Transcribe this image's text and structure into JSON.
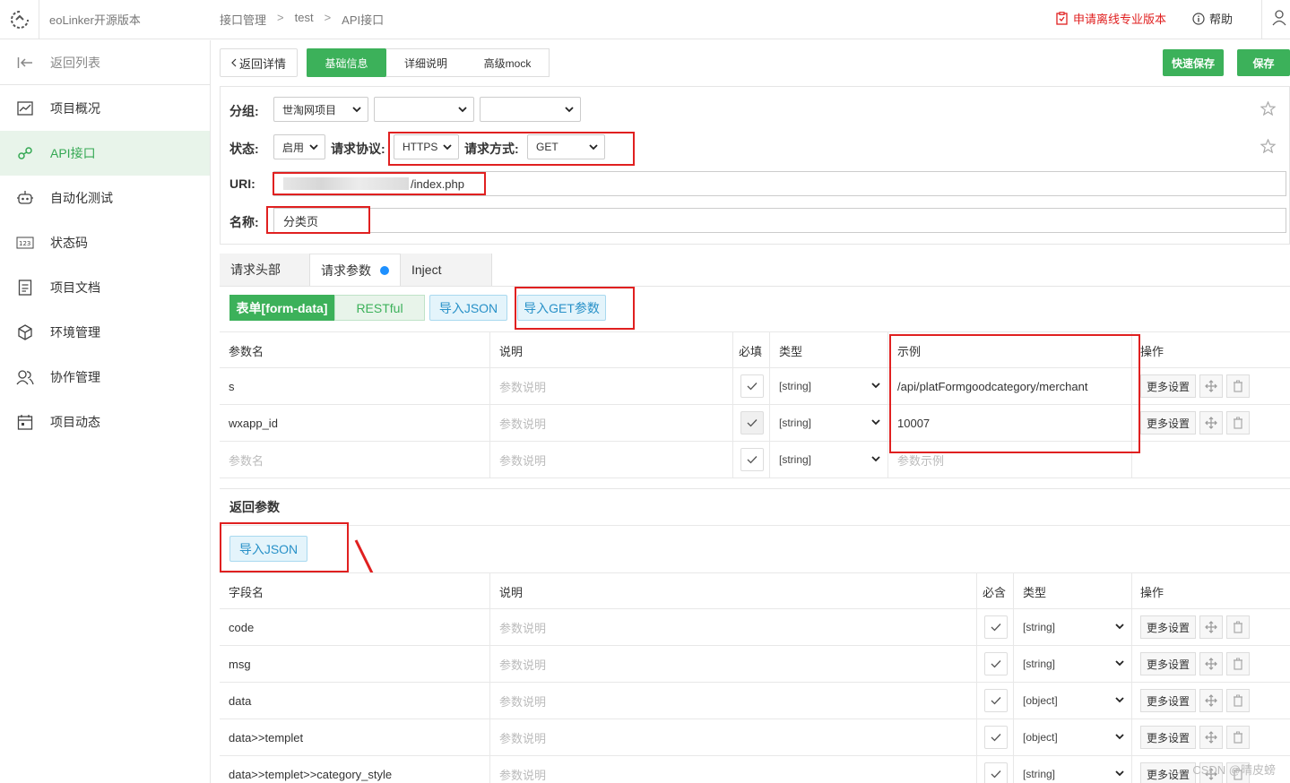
{
  "header": {
    "app_name": "eoLinker开源版本",
    "breadcrumbs": [
      "接口管理",
      "test",
      "API接口"
    ],
    "breadcrumb_sep": ">",
    "apply_label": "申请离线专业版本",
    "help_label": "帮助"
  },
  "sidebar": {
    "back_label": "返回列表",
    "items": [
      {
        "label": "项目概况",
        "icon": "chart-icon"
      },
      {
        "label": "API接口",
        "icon": "link-icon"
      },
      {
        "label": "自动化测试",
        "icon": "robot-icon"
      },
      {
        "label": "状态码",
        "icon": "code-icon"
      },
      {
        "label": "项目文档",
        "icon": "doc-icon"
      },
      {
        "label": "环境管理",
        "icon": "cube-icon"
      },
      {
        "label": "协作管理",
        "icon": "users-icon"
      },
      {
        "label": "项目动态",
        "icon": "calendar-icon"
      }
    ],
    "active": "API接口"
  },
  "toolbar": {
    "back_detail": "返回详情",
    "tabs": [
      "基础信息",
      "详细说明",
      "高级mock"
    ],
    "active_tab": "基础信息",
    "quick_save": "快速保存",
    "save": "保存"
  },
  "form": {
    "group_label": "分组:",
    "group_value": "世淘网项目",
    "status_label": "状态:",
    "status_value": "启用",
    "protocol_label": "请求协议:",
    "protocol_value": "HTTPS",
    "method_label": "请求方式:",
    "method_value": "GET",
    "uri_label": "URI:",
    "uri_value": "/index.php",
    "name_label": "名称:",
    "name_value": "分类页"
  },
  "request_tabs": [
    "请求头部",
    "请求参数",
    "Inject"
  ],
  "request_buttons": {
    "formdata": "表单[form-data]",
    "restful": "RESTful",
    "import_json": "导入JSON",
    "import_get": "导入GET参数"
  },
  "request_table": {
    "headers": [
      "参数名",
      "说明",
      "必填",
      "类型",
      "示例",
      "操作"
    ],
    "rows": [
      {
        "name": "s",
        "desc": "参数说明",
        "type": "[string]",
        "example": "/api/platFormgoodcategory/merchant"
      },
      {
        "name": "wxapp_id",
        "desc": "参数说明",
        "type": "[string]",
        "example": "10007"
      }
    ],
    "empty_row": {
      "name": "参数名",
      "desc": "参数说明",
      "type": "[string]",
      "example": "参数示例"
    },
    "more_settings": "更多设置"
  },
  "response": {
    "title": "返回参数",
    "import_json": "导入JSON",
    "headers": [
      "字段名",
      "说明",
      "必含",
      "类型",
      "操作"
    ],
    "rows": [
      {
        "name": "code",
        "desc": "参数说明",
        "type": "[string]"
      },
      {
        "name": "msg",
        "desc": "参数说明",
        "type": "[string]"
      },
      {
        "name": "data",
        "desc": "参数说明",
        "type": "[object]"
      },
      {
        "name": "data>>templet",
        "desc": "参数说明",
        "type": "[object]"
      },
      {
        "name": "data>>templet>>category_style",
        "desc": "参数说明",
        "type": "[string]"
      }
    ],
    "more_settings": "更多设置"
  },
  "watermark": "CSDN @晴皮螃",
  "colors": {
    "green": "#3cb15a",
    "red": "#e02020",
    "blue": "#2891c8"
  }
}
